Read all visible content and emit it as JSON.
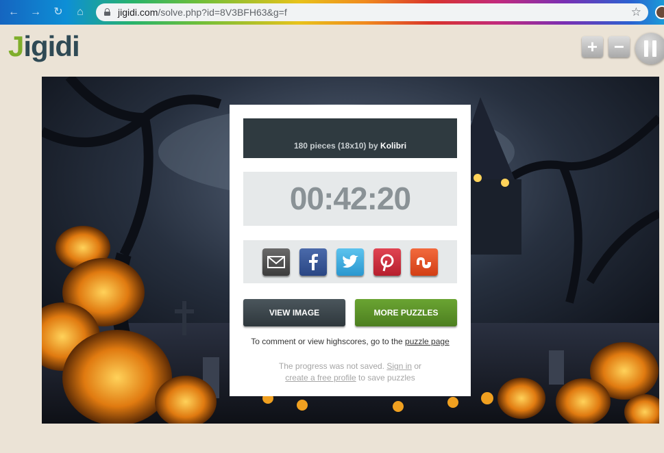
{
  "browser": {
    "url_domain": "jigidi.com",
    "url_path": "/solve.php?id=8V3BFH63&g=f",
    "nav_icons": [
      "back-arrow-icon",
      "forward-arrow-icon",
      "reload-icon",
      "home-icon"
    ]
  },
  "header": {
    "logo_first": "J",
    "logo_rest": "igidi",
    "controls": [
      "zoom-in-icon",
      "zoom-out-icon",
      "pause-icon"
    ]
  },
  "dialog": {
    "pieces": "180 pieces (18x10)",
    "by": " by ",
    "author": "Kolibri",
    "timer": "00:42:20",
    "share": [
      "email",
      "facebook",
      "twitter",
      "pinterest",
      "stumbleupon"
    ],
    "view_image": "VIEW IMAGE",
    "more_puzzles": "MORE PUZZLES",
    "comment_text": "To comment or view highscores, go to the ",
    "comment_link": "puzzle page",
    "progress_text": "The progress was not saved. ",
    "sign_in": "Sign in",
    "or": " or",
    "create_profile": "create a free profile",
    "save_text": " to save puzzles"
  },
  "colors": {
    "page_bg": "#ebe3d6",
    "logo_green": "#7fae2b",
    "logo_dark": "#2f4a55",
    "more_puzzles_green": "#5a9128",
    "view_image_dark": "#3a454a"
  }
}
